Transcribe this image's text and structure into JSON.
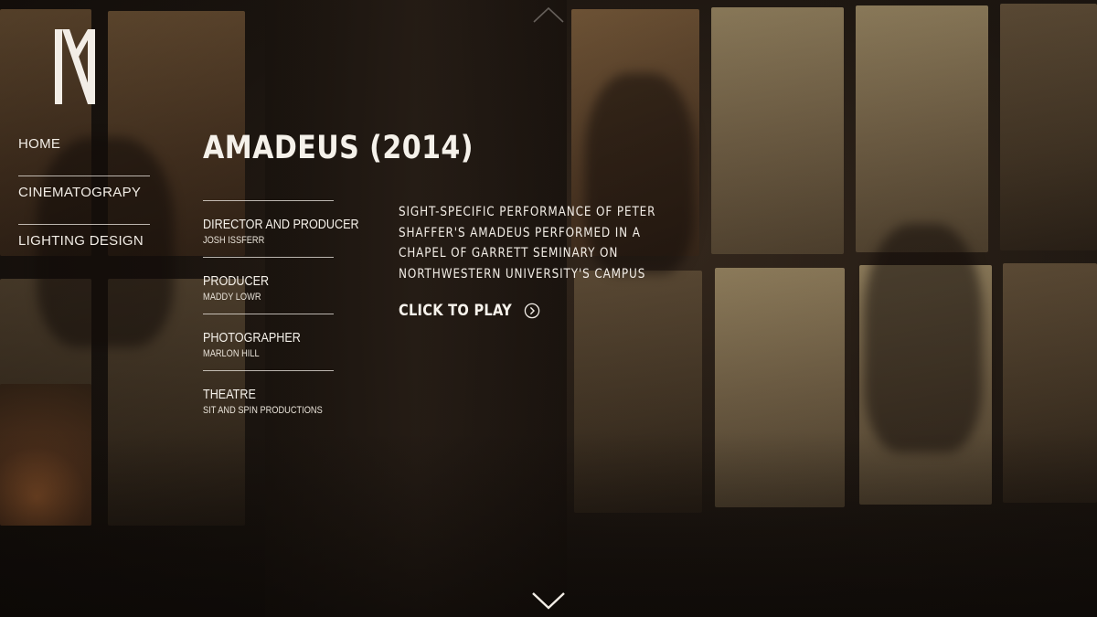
{
  "nav": {
    "items": [
      {
        "label": "HOME"
      },
      {
        "label": "CINEMATOGRAPY"
      },
      {
        "label": "LIGHTING DESIGN"
      }
    ]
  },
  "project": {
    "title": "AMADEUS (2014)",
    "description": "SIGHT-SPECIFIC PERFORMANCE OF PETER SHAFFER'S AMADEUS PERFORMED IN A CHAPEL OF GARRETT SEMINARY ON NORTHWESTERN UNIVERSITY'S CAMPUS",
    "play_label": "CLICK TO PLAY",
    "credits": [
      {
        "role": "DIRECTOR AND PRODUCER",
        "name": "JOSH ISSFERR"
      },
      {
        "role": "PRODUCER",
        "name": "MADDY LOWR"
      },
      {
        "role": "PHOTOGRAPHER",
        "name": "MARLON HILL"
      },
      {
        "role": "THEATRE",
        "name": "SIT AND SPIN PRODUCTIONS"
      }
    ]
  },
  "icons": {
    "logo": "nm-monogram-logo",
    "scroll_up": "chevron-up-icon",
    "scroll_down": "chevron-down-icon",
    "play": "circle-chevron-right-icon"
  },
  "colors": {
    "text": "#f2ede6",
    "background": "#1c1510"
  }
}
